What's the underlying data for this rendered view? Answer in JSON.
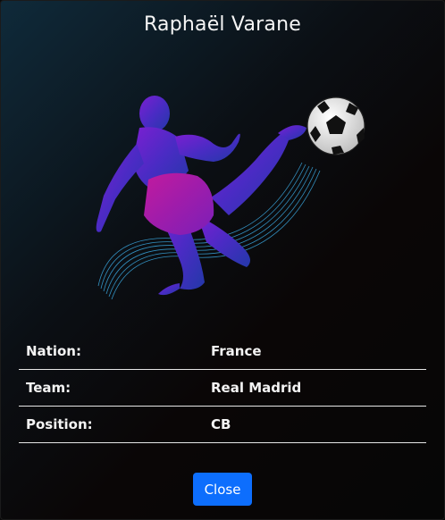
{
  "modal": {
    "title": "Raphaël Varane",
    "rows": [
      {
        "label": "Nation:",
        "value": "France"
      },
      {
        "label": "Team:",
        "value": "Real Madrid"
      },
      {
        "label": "Position:",
        "value": "CB"
      }
    ],
    "close_label": "Close",
    "image_icon": "bicycle-kick-player-illustration",
    "colors": {
      "accent": "#0d6efd",
      "player_purple": "#6a1fb8",
      "player_magenta": "#a51fa0",
      "player_blue": "#2f3fb6",
      "trail_cyan": "#3aa8e0"
    }
  }
}
